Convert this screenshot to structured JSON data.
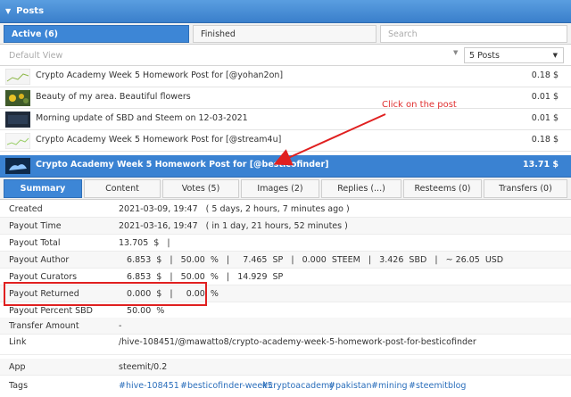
{
  "header": {
    "title": "Posts"
  },
  "tabs": {
    "active": "Active (6)",
    "finished": "Finished",
    "search_placeholder": "Search"
  },
  "filter": {
    "view": "Default View",
    "count": "5 Posts"
  },
  "posts": [
    {
      "title": "Crypto Academy Week 5 Homework Post for [@yohan2on]",
      "value": "0.18 $"
    },
    {
      "title": "Beauty of my area. Beautiful flowers",
      "value": "0.01 $"
    },
    {
      "title": "Morning update of SBD and Steem on 12-03-2021",
      "value": "0.01 $"
    },
    {
      "title": "Crypto Academy Week 5 Homework Post for [@stream4u]",
      "value": "0.18 $"
    },
    {
      "title": "Crypto Academy Week 5 Homework Post for [@besticofinder]",
      "value": "13.71 $"
    }
  ],
  "detail_tabs": [
    "Summary",
    "Content",
    "Votes (5)",
    "Images (2)",
    "Replies (...)",
    "Resteems (0)",
    "Transfers (0)"
  ],
  "details": {
    "created": {
      "label": "Created",
      "value": "2021-03-09, 19:47   ( 5 days, 2 hours, 7 minutes ago )"
    },
    "payout_time": {
      "label": "Payout Time",
      "value": "2021-03-16, 19:47   ( in 1 day, 21 hours, 52 minutes )"
    },
    "payout_total": {
      "label": "Payout Total",
      "value": "13.705  $   |"
    },
    "payout_author": {
      "label": "Payout Author",
      "value": "   6.853  $   |   50.00  %   |     7.465  SP   |   0.000  STEEM   |   3.426  SBD   |   ~ 26.05  USD"
    },
    "payout_curators": {
      "label": "Payout Curators",
      "value": "   6.853  $   |   50.00  %   |   14.929  SP"
    },
    "payout_returned": {
      "label": "Payout Returned",
      "value": "   0.000  $   |     0.00  %"
    },
    "payout_percent_sbd": {
      "label": "Payout Percent SBD",
      "value": "   50.00  %"
    },
    "transfer_amount": {
      "label": "Transfer Amount",
      "value": "-"
    },
    "link": {
      "label": "Link",
      "value": "/hive-108451/@mawatto8/crypto-academy-week-5-homework-post-for-besticofinder"
    },
    "app": {
      "label": "App",
      "value": "steemit/0.2"
    },
    "tags": {
      "label": "Tags",
      "values": [
        "#hive-108451",
        "#besticofinder-week5",
        "#cryptoacademy",
        "#pakistan",
        "#mining",
        "#steemitblog"
      ]
    }
  },
  "annotation": {
    "text": "Click on the post",
    "color": "#e03030"
  }
}
